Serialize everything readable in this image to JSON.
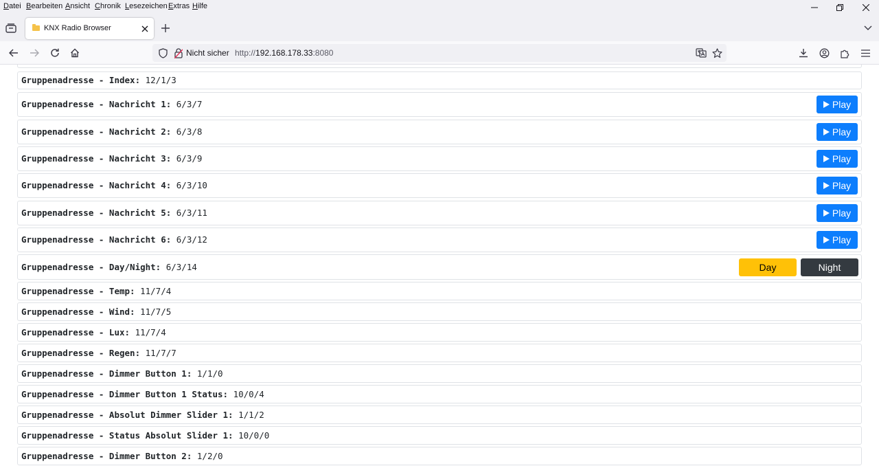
{
  "menubar": {
    "items": [
      "Datei",
      "Bearbeiten",
      "Ansicht",
      "Chronik",
      "Lesezeichen",
      "Extras",
      "Hilfe"
    ],
    "accels": [
      "D",
      "B",
      "A",
      "C",
      "L",
      "E",
      "H"
    ]
  },
  "tab": {
    "title": "KNX Radio Browser"
  },
  "urlbar": {
    "security_label": "Nicht sicher",
    "scheme": "http://",
    "host": "192.168.178.33",
    "port": ":8080"
  },
  "rows": [
    {
      "label": "Gruppenadresse - Index:",
      "value": "12/1/3"
    },
    {
      "label": "Gruppenadresse - Nachricht 1:",
      "value": "6/3/7",
      "action": "Play"
    },
    {
      "label": "Gruppenadresse - Nachricht 2:",
      "value": "6/3/8",
      "action": "Play"
    },
    {
      "label": "Gruppenadresse - Nachricht 3:",
      "value": "6/3/9",
      "action": "Play"
    },
    {
      "label": "Gruppenadresse - Nachricht 4:",
      "value": "6/3/10",
      "action": "Play"
    },
    {
      "label": "Gruppenadresse - Nachricht 5:",
      "value": "6/3/11",
      "action": "Play"
    },
    {
      "label": "Gruppenadresse - Nachricht 6:",
      "value": "6/3/12",
      "action": "Play"
    },
    {
      "label": "Gruppenadresse - Day/Night:",
      "value": "6/3/14",
      "day": "Day",
      "night": "Night"
    },
    {
      "label": "Gruppenadresse - Temp:",
      "value": "11/7/4"
    },
    {
      "label": "Gruppenadresse - Wind:",
      "value": "11/7/5"
    },
    {
      "label": "Gruppenadresse - Lux:",
      "value": "11/7/4"
    },
    {
      "label": "Gruppenadresse - Regen:",
      "value": "11/7/7"
    },
    {
      "label": "Gruppenadresse - Dimmer Button 1:",
      "value": "1/1/0"
    },
    {
      "label": "Gruppenadresse - Dimmer Button 1 Status:",
      "value": "10/0/4"
    },
    {
      "label": "Gruppenadresse - Absolut Dimmer Slider 1:",
      "value": "1/1/2"
    },
    {
      "label": "Gruppenadresse - Status Absolut Slider 1:",
      "value": "10/0/0"
    },
    {
      "label": "Gruppenadresse - Dimmer Button 2:",
      "value": "1/2/0"
    }
  ],
  "colors": {
    "play_button": "#0d7efd",
    "day_button": "#ffc107",
    "night_button": "#343a40"
  }
}
